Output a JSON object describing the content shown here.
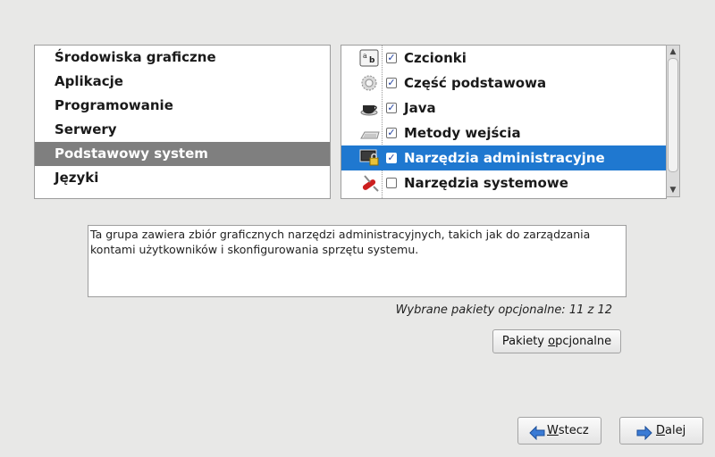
{
  "categories": {
    "items": [
      {
        "label": "Środowiska graficzne",
        "selected": false
      },
      {
        "label": "Aplikacje",
        "selected": false
      },
      {
        "label": "Programowanie",
        "selected": false
      },
      {
        "label": "Serwery",
        "selected": false
      },
      {
        "label": "Podstawowy system",
        "selected": true
      },
      {
        "label": "Języki",
        "selected": false
      }
    ]
  },
  "groups": {
    "items": [
      {
        "label": "Czcionki",
        "checked": true,
        "icon": "fonts-icon",
        "selected": false
      },
      {
        "label": "Część podstawowa",
        "checked": true,
        "icon": "gear-icon",
        "selected": false
      },
      {
        "label": "Java",
        "checked": true,
        "icon": "coffee-cup-icon",
        "selected": false
      },
      {
        "label": "Metody wejścia",
        "checked": true,
        "icon": "keyboard-icon",
        "selected": false
      },
      {
        "label": "Narzędzia administracyjne",
        "checked": true,
        "icon": "admin-monitor-lock-icon",
        "selected": true
      },
      {
        "label": "Narzędzia systemowe",
        "checked": false,
        "icon": "swiss-knife-icon",
        "selected": false
      }
    ]
  },
  "description": {
    "line1": "Ta grupa zawiera zbiór graficznych narzędzi administracyjnych, takich jak do zarządzania",
    "line2": "kontami użytkowników i skonfigurowania sprzętu systemu."
  },
  "optional_count": "Wybrane pakiety opcjonalne: 11 z 12",
  "buttons": {
    "optional_pre": "Pakiety ",
    "optional_mn": "o",
    "optional_post": "pcjonalne",
    "back_mn": "W",
    "back_post": "stecz",
    "next_mn": "D",
    "next_post": "alej"
  },
  "colors": {
    "selection": "#1f78d0",
    "category_selection": "#7f7f7f",
    "background": "#e8e8e7"
  }
}
